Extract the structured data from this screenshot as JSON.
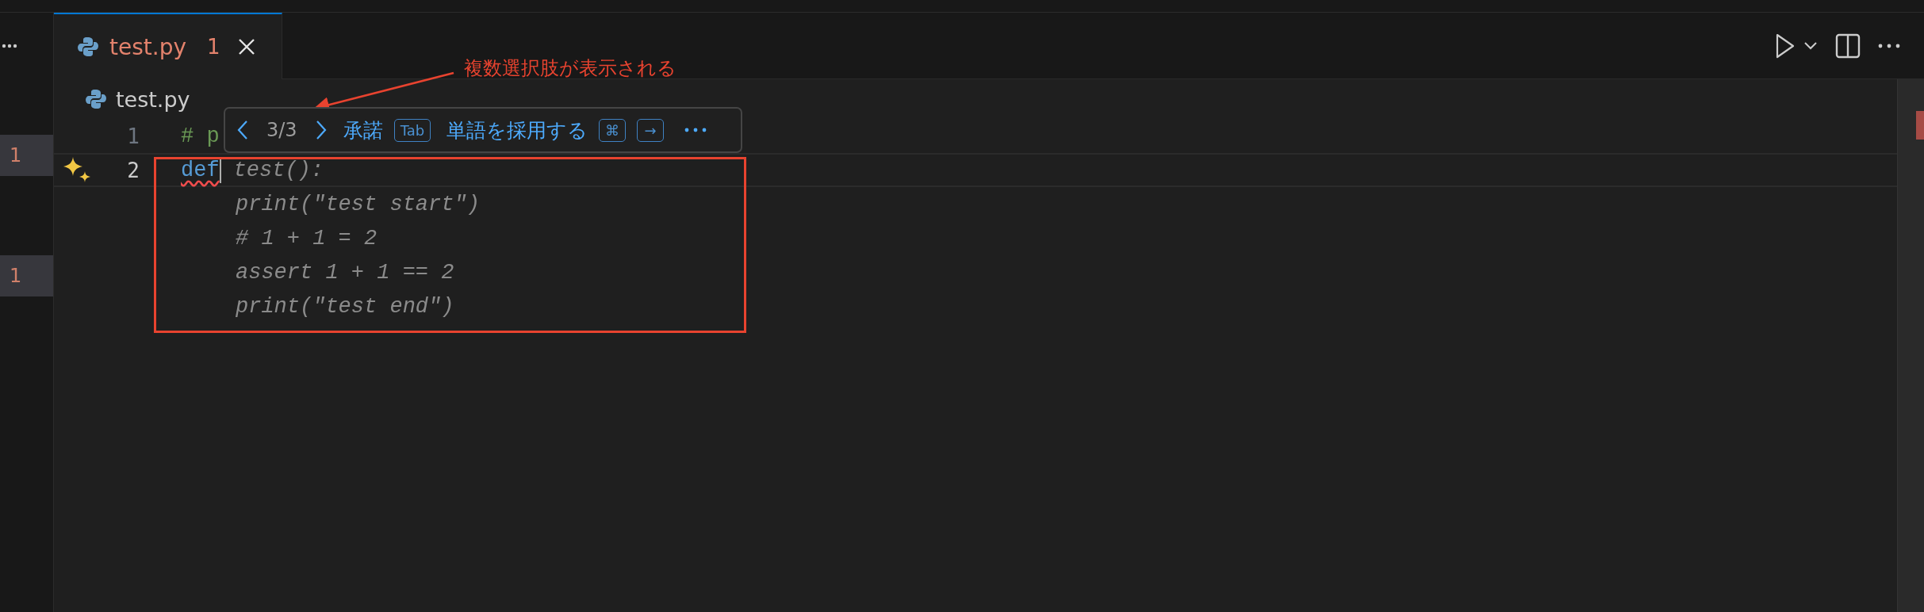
{
  "sidebar": {
    "badges": [
      "1",
      "1"
    ]
  },
  "tabs": [
    {
      "label": "test.py",
      "badge": "1",
      "selected": true
    }
  ],
  "breadcrumb": "test.py",
  "editor": {
    "lines": [
      {
        "number": "1",
        "code": "# p",
        "kind": "comment",
        "current": false,
        "sparkle": false
      },
      {
        "number": "2",
        "code": "def",
        "kind": "keyword",
        "current": true,
        "sparkle": true,
        "ghost": "test():"
      }
    ],
    "ghost_lines": [
      "print(\"test start\")",
      "# 1 + 1 = 2",
      "assert 1 + 1 == 2",
      "print(\"test end\")"
    ]
  },
  "suggestion_toolbar": {
    "counter": "3/3",
    "accept": "承諾",
    "accept_key": "Tab",
    "accept_word": "単語を採用する",
    "word_keys": [
      "⌘",
      "→"
    ]
  },
  "annotation": {
    "text": "複数選択肢が表示される"
  }
}
